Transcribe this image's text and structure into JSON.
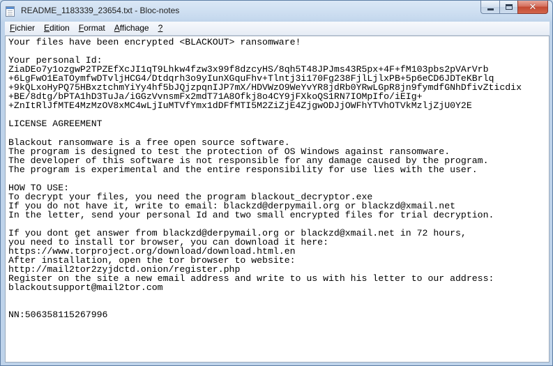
{
  "window": {
    "title": "README_1183339_23654.txt - Bloc-notes",
    "close_glyph": "✕"
  },
  "menu": [
    {
      "first": "F",
      "rest": "ichier"
    },
    {
      "first": "E",
      "rest": "dition"
    },
    {
      "first": "F",
      "rest": "ormat"
    },
    {
      "first": "A",
      "rest": "ffichage"
    },
    {
      "first": "?",
      "rest": ""
    }
  ],
  "document": {
    "lines": [
      "Your files have been encrypted <BLACKOUT> ransomware!",
      "",
      "Your personal Id:",
      "ZiaDEo7y1ozgwP2TPZEfXcJI1qT9Lhkw4fzw3x99f8dzcyHS/8qh5T48JPJms43R5px+4F+fM103pbs2pVArVrb",
      "+6LgFwO1EaTOymfwDTvljHCG4/Dtdqrh3o9yIunXGquFhv+Tlntj3i170Fg238FjlLjlxPB+5p6eCD6JDTeKBrlq",
      "+9kQLxoHyPQ75HBxztchmYiYy4hf5bJQjzpqnIJP7mX/HDVWzO9WeYvYR8jdRb0YRwLGpR8jn9fymdfGNhDfivZticdix",
      "+BE/8dtg/bPTA1hD3TuJa/iGGzVvnsmFx2mdT71A8Ofkj8o4CY9jFXkoQS1RN7IOMpIfo/iEIg+",
      "+ZnItRlJfMTE4MzMzOV8xMC4wLjIuMTVfYmx1dDFfMTI5M2ZiZjE4ZjgwODJjOWFhYTVhOTVkMzljZjU0Y2E",
      "",
      "LICENSE AGREEMENT",
      "",
      "Blackout ransomware is a free open source software.",
      "The program is designed to test the protection of OS Windows against ransomware.",
      "The developer of this software is not responsible for any damage caused by the program.",
      "The program is experimental and the entire responsibility for use lies with the user.",
      "",
      "HOW TO USE:",
      "To decrypt your files, you need the program blackout_decryptor.exe",
      "If you do not have it, write to email: blackzd@derpymail.org or blackzd@xmail.net",
      "In the letter, send your personal Id and two small encrypted files for trial decryption.",
      "",
      "If you dont get answer from blackzd@derpymail.org or blackzd@xmail.net in 72 hours,",
      "you need to install tor browser, you can download it here:",
      "https://www.torproject.org/download/download.html.en",
      "After installation, open the tor browser to website:",
      "http://mail2tor2zyjdctd.onion/register.php",
      "Register on the site a new email address and write to us with his letter to our address:",
      "blackoutsupport@mail2tor.com",
      "",
      "",
      "NN:506358115267996"
    ]
  }
}
